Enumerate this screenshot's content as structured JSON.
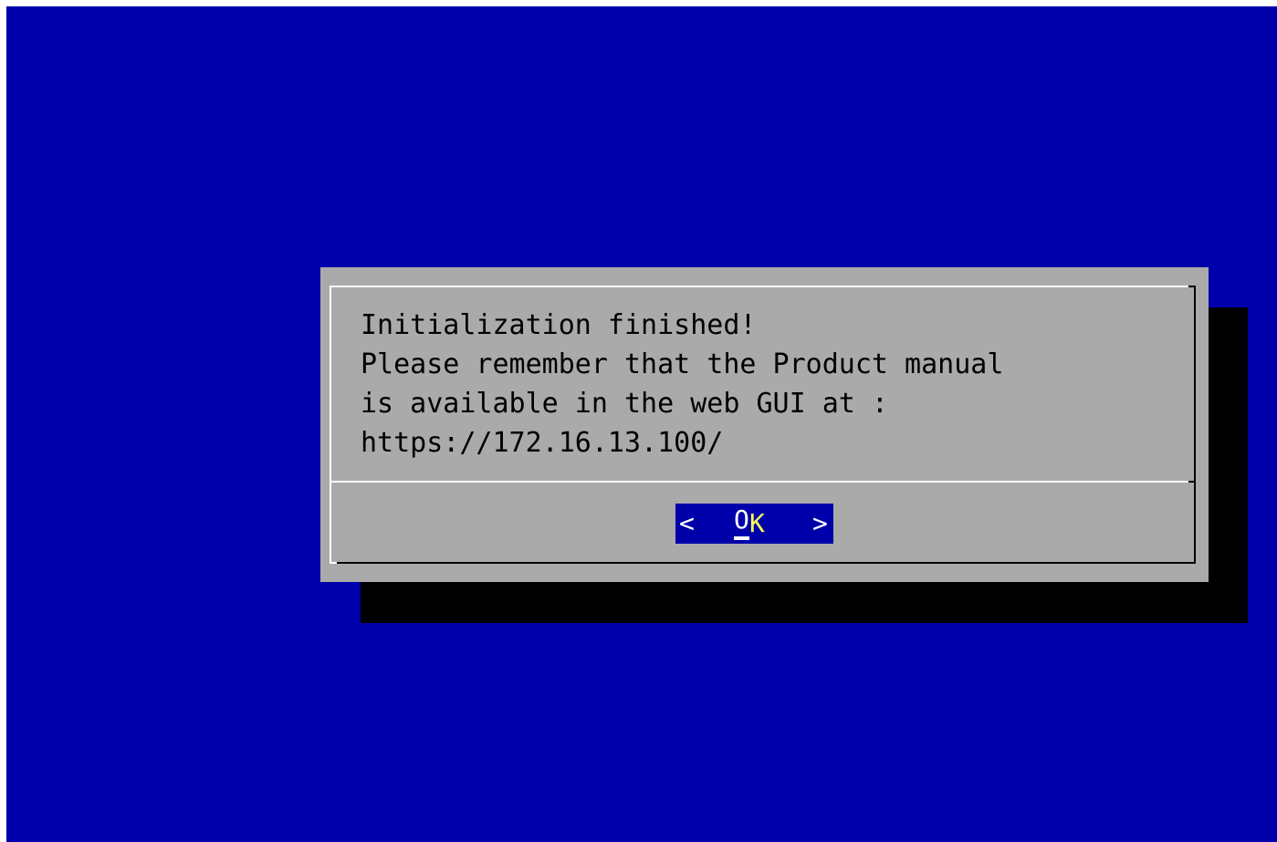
{
  "dialog": {
    "message_lines": [
      "Initialization finished!",
      "Please remember that the Product manual",
      "is available in the web GUI at :",
      "https://172.16.13.100/"
    ],
    "ok_button": {
      "left_bracket": "<",
      "hotkey": "O",
      "label_rest": "K",
      "right_bracket": ">"
    }
  },
  "colors": {
    "background": "#0000aa",
    "dialog": "#aaaaaa",
    "shadow": "#000000",
    "button_highlight": "#0000aa",
    "button_text": "#ffff55"
  }
}
